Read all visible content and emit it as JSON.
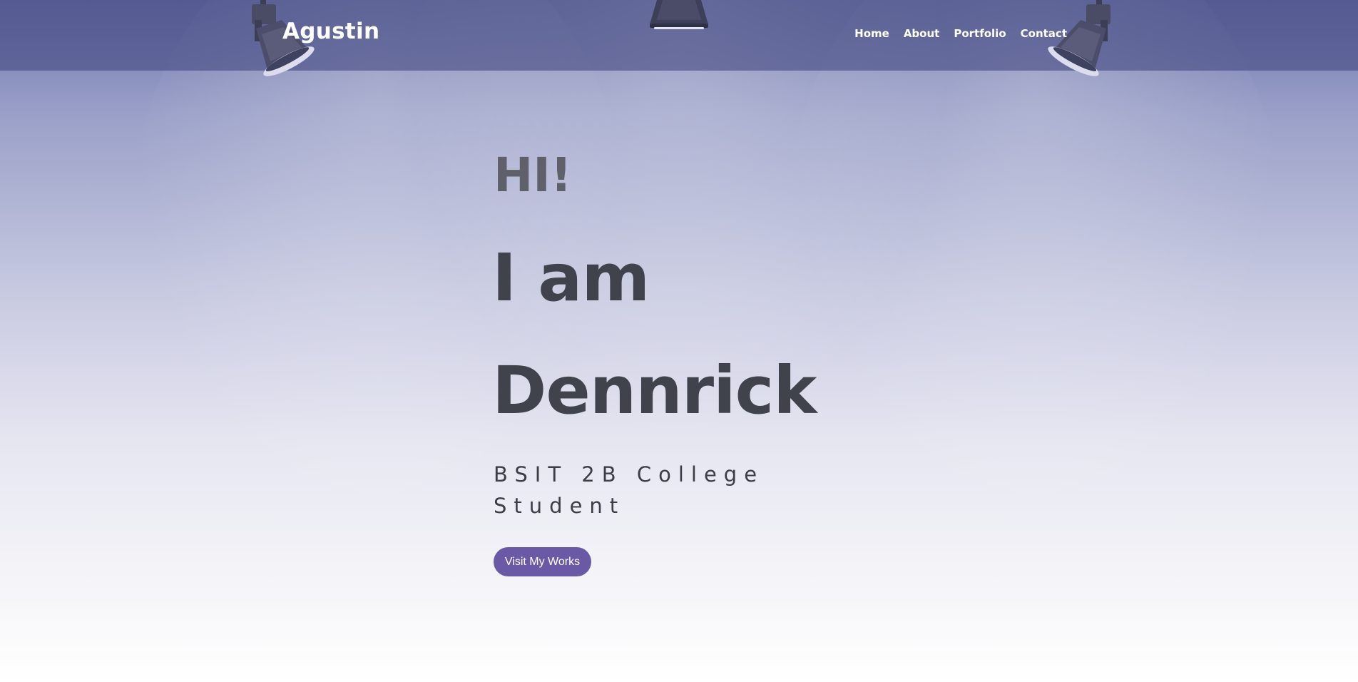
{
  "navbar": {
    "brand": "Agustin",
    "links": [
      {
        "label": "Home"
      },
      {
        "label": "About"
      },
      {
        "label": "Portfolio"
      },
      {
        "label": "Contact"
      }
    ]
  },
  "hero": {
    "greeting": "HI!",
    "name_line_1": "I am",
    "name_line_2": "Dennrick",
    "subtitle": "BSIT 2B College Student",
    "cta_label": "Visit My Works"
  },
  "icons": {
    "lamp_left": "spotlight-icon",
    "lamp_center": "spotlight-icon",
    "lamp_right": "spotlight-icon"
  },
  "colors": {
    "navbar": "#464a82",
    "button": "#6a5aa5",
    "heading": "#40434b",
    "greeting": "#5f6069",
    "background_top": "#6f76ab",
    "background_bottom": "#ffffff"
  }
}
